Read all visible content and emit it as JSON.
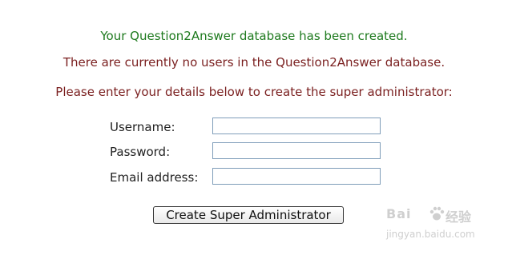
{
  "messages": {
    "success": "Your Question2Answer database has been created.",
    "notice": "There are currently no users in the Question2Answer database.",
    "prompt": "Please enter your details below to create the super administrator:"
  },
  "form": {
    "username_label": "Username:",
    "username_value": "",
    "password_label": "Password:",
    "password_value": "",
    "email_label": "Email address:",
    "email_value": "",
    "submit_label": "Create Super Administrator"
  },
  "watermark": {
    "logo_text": "Bai",
    "logo_text_2": "经验",
    "url": "jingyan.baidu.com"
  },
  "colors": {
    "success_text": "#1e7a1e",
    "notice_text": "#7a1f1f",
    "input_border": "#7f9db9"
  }
}
